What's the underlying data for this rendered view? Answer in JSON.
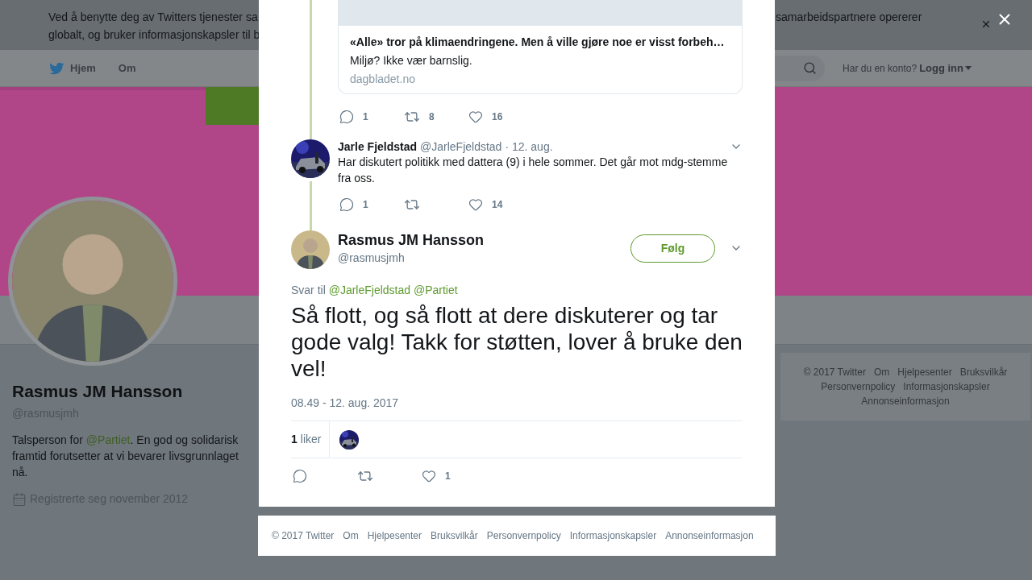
{
  "cookie_banner": {
    "text_left": [
      "Ved å benytte deg av Twitters tjenester sa",
      "globalt, og bruker informasjonskapsler til b"
    ],
    "text_right": "samarbeidspartnere opererer"
  },
  "nav": {
    "items": [
      "Hjem",
      "Om"
    ],
    "account_prompt": "Har du en konto?",
    "login": "Logg inn"
  },
  "profile": {
    "name": "Rasmus JM Hansson",
    "handle": "@rasmusjmh",
    "bio_before": "Talsperson for ",
    "bio_link": "@Partiet",
    "bio_after": ". En god og solidarisk framtid forutsetter at vi bevarer livsgrunnlaget nå.",
    "joined": "Registrerte seg november 2012"
  },
  "side_footer": [
    "© 2017 Twitter",
    "Om",
    "Hjelpesenter",
    "Bruksvilkår",
    "Personvernpolicy",
    "Informasjonskapsler",
    "Annonseinformasjon"
  ],
  "modal": {
    "card": {
      "title": "«Alle» tror på klimaendringene. Men å ville gjøre noe er visst forbeh…",
      "description": "Miljø? Ikke vær barnslig.",
      "domain": "dagbladet.no",
      "actions": [
        {
          "kind": "reply",
          "count": "1"
        },
        {
          "kind": "retweet",
          "count": "8"
        },
        {
          "kind": "like",
          "count": "16"
        }
      ]
    },
    "reply_tweet": {
      "name": "Jarle Fjeldstad",
      "handle": "@JarleFjeldstad",
      "date": "· 12. aug.",
      "text": "Har diskutert politikk med dattera (9) i hele sommer. Det går mot mdg-stemme fra oss.",
      "actions": [
        {
          "kind": "reply",
          "count": "1"
        },
        {
          "kind": "retweet"
        },
        {
          "kind": "like",
          "count": "14"
        }
      ]
    },
    "main_tweet": {
      "name": "Rasmus JM Hansson",
      "handle": "@rasmusjmh",
      "follow": "Følg",
      "reply_to_label": "Svar til",
      "reply_to": [
        "@JarleFjeldstad",
        "@Partiet"
      ],
      "text": "Så flott, og så flott at dere diskuterer og tar gode valg! Takk for støtten, lover å bruke den vel!",
      "timestamp": "08.49 - 12. aug. 2017",
      "likes_count": "1",
      "likes_label": "liker",
      "actions": [
        {
          "kind": "reply"
        },
        {
          "kind": "retweet"
        },
        {
          "kind": "like",
          "count": "1"
        }
      ]
    }
  },
  "footer": [
    "© 2017 Twitter",
    "Om",
    "Hjelpesenter",
    "Bruksvilkår",
    "Personvernpolicy",
    "Informasjonskapsler",
    "Annonseinformasjon"
  ]
}
